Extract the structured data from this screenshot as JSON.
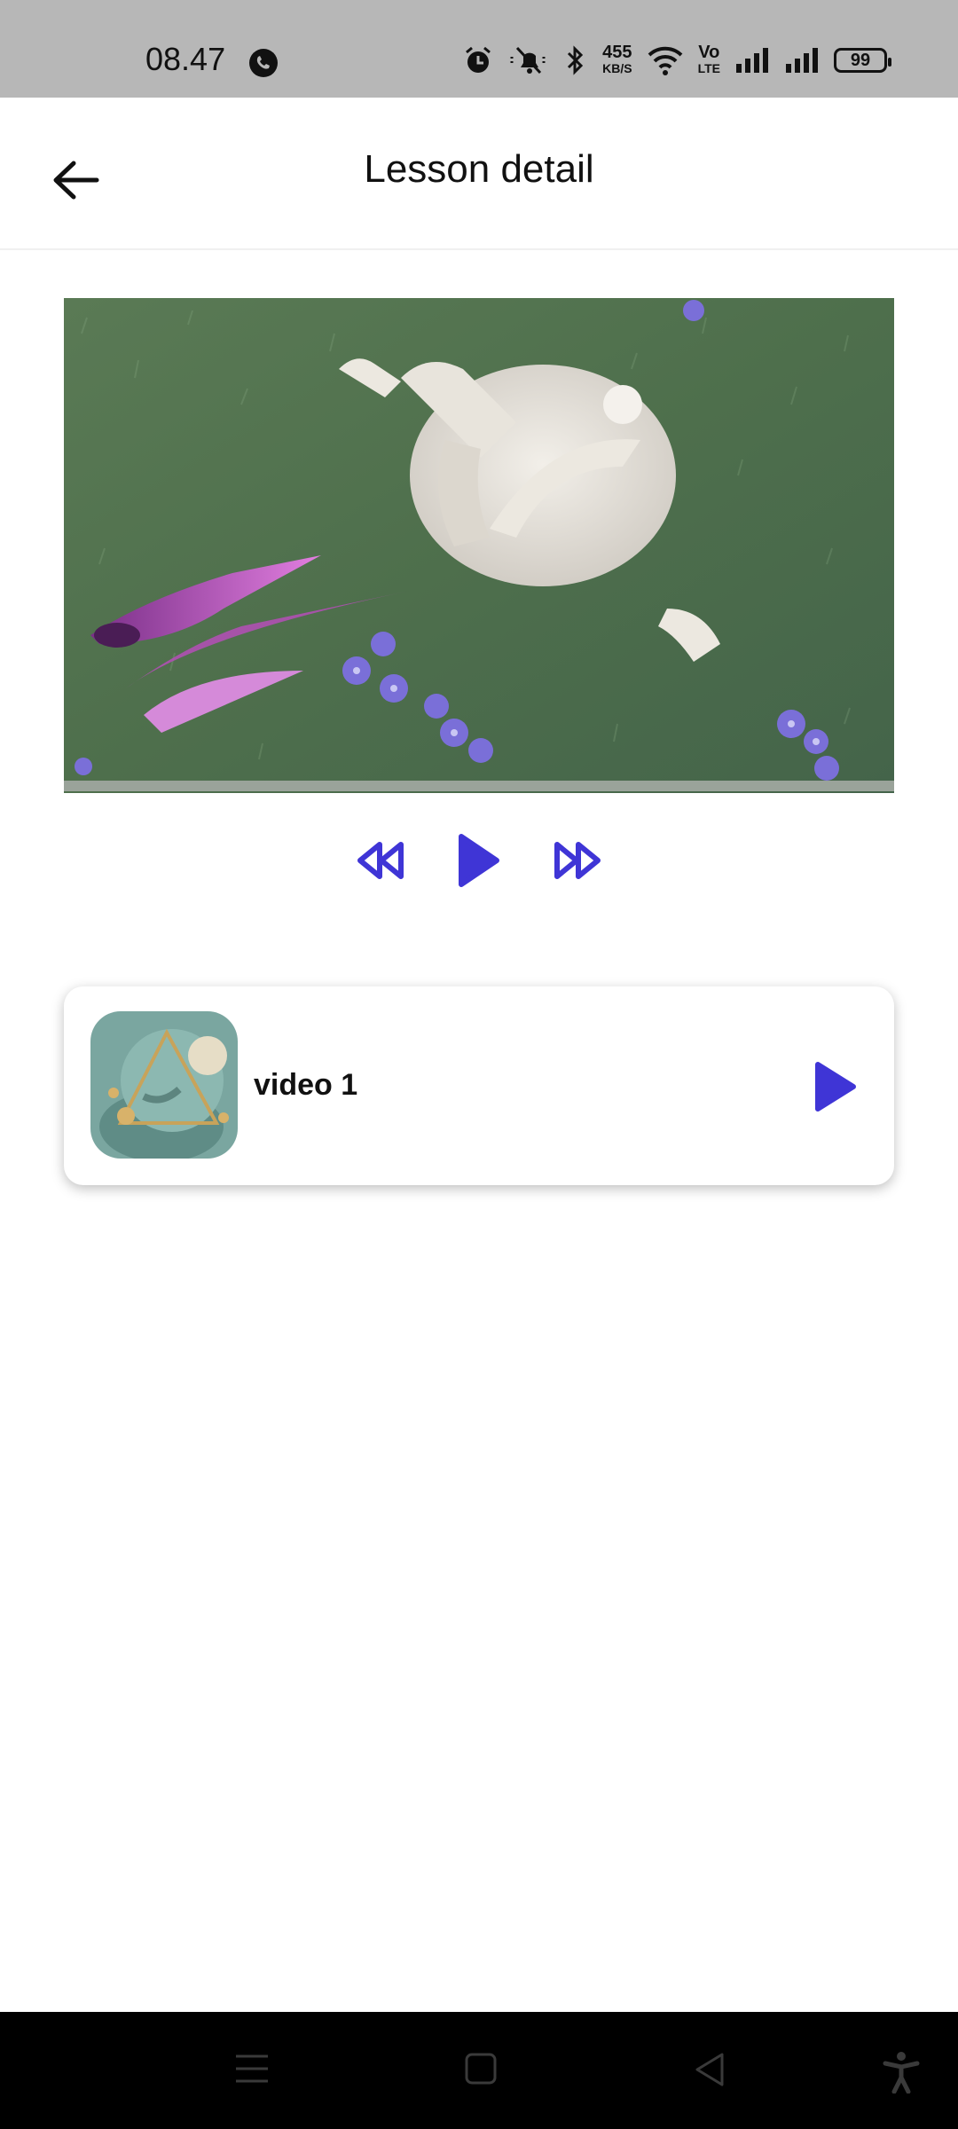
{
  "status_bar": {
    "time": "08.47",
    "net_speed_value": "455",
    "net_speed_unit": "KB/S",
    "network_type_top": "Vo",
    "network_type_bottom": "LTE",
    "battery_level": "99"
  },
  "header": {
    "title": "Lesson detail"
  },
  "video": {
    "progress_fraction": 0.0
  },
  "lesson_list": [
    {
      "title": "video 1"
    }
  ],
  "colors": {
    "accent": "#3f35d6",
    "status_bar_bg": "#b7b7b7",
    "nav_bar_bg": "#000000"
  },
  "icons": {
    "back": "arrow-left-icon",
    "rewind": "rewind-icon",
    "play": "play-icon",
    "forward": "fast-forward-icon",
    "nav_menu": "menu-icon",
    "nav_home": "square-home-icon",
    "nav_back": "triangle-back-icon",
    "nav_accessibility": "accessibility-icon"
  }
}
